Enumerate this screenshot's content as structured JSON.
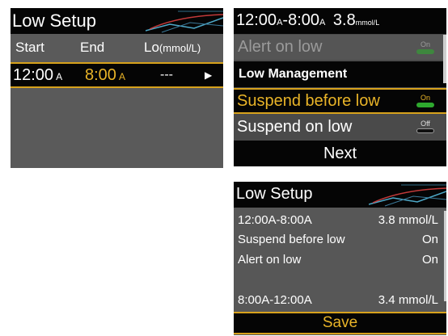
{
  "screen1": {
    "title": "Low Setup",
    "columns": {
      "start": "Start",
      "end": "End",
      "lo": "Lo",
      "lo_unit": "(mmol/L)"
    },
    "row": {
      "start": "12:00",
      "start_suffix": "A",
      "end": "8:00",
      "end_suffix": "A",
      "lo": "---",
      "arrow": "▶"
    }
  },
  "screen2": {
    "title_range": "12:00",
    "title_a1": "A",
    "title_dash": "-8:00",
    "title_a2": "A",
    "title_value": "3.8",
    "title_unit": "mmol/L",
    "items": [
      {
        "label": "Alert on low",
        "toggle": "On"
      },
      {
        "label": "Low Management"
      },
      {
        "label": "Suspend before low",
        "toggle": "On"
      },
      {
        "label": "Suspend on low",
        "toggle": "Off"
      }
    ],
    "next_label": "Next"
  },
  "screen3": {
    "title": "Low Setup",
    "rows": [
      {
        "left": "12:00A-8:00A",
        "right": "3.8 mmol/L"
      },
      {
        "left": "Suspend before low",
        "right": "On"
      },
      {
        "left": "Alert on low",
        "right": "On"
      },
      {
        "left": "8:00A-12:00A",
        "right": "3.4 mmol/L"
      }
    ],
    "save_label": "Save"
  },
  "colors": {
    "selected_text": "#e9b428",
    "highlight_border": "#d7a21c",
    "toggle_on": "#2ea82e",
    "toggle_off": "#111111",
    "screen_bg": "#555555",
    "header_bg": "#050505"
  }
}
